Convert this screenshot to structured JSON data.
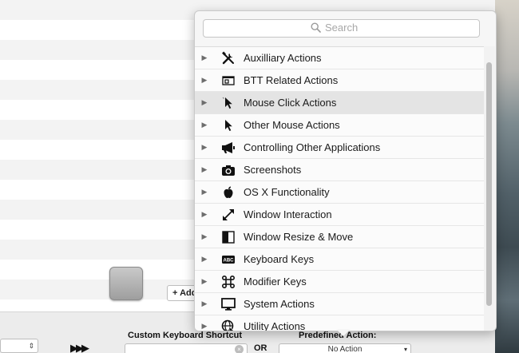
{
  "background": {
    "add_button": "+ Add",
    "shortcut_label": "Custom Keyboard Shortcut",
    "or_label": "OR",
    "predefined_label": "Predefined Action:",
    "predefined_value": "No Action"
  },
  "popover": {
    "search_placeholder": "Search",
    "items": [
      {
        "label": "Auxilliary Actions",
        "icon": "tools-icon"
      },
      {
        "label": "BTT Related Actions",
        "icon": "btt-window-icon"
      },
      {
        "label": "Mouse Click Actions",
        "icon": "cursor-click-icon",
        "highlighted": true
      },
      {
        "label": "Other Mouse Actions",
        "icon": "cursor-icon"
      },
      {
        "label": "Controlling Other Applications",
        "icon": "megaphone-icon"
      },
      {
        "label": "Screenshots",
        "icon": "camera-icon"
      },
      {
        "label": "OS X Functionality",
        "icon": "apple-icon"
      },
      {
        "label": "Window Interaction",
        "icon": "resize-arrows-icon"
      },
      {
        "label": "Window Resize & Move",
        "icon": "half-window-icon"
      },
      {
        "label": "Keyboard Keys",
        "icon": "abc-keyboard-icon"
      },
      {
        "label": "Modifier Keys",
        "icon": "command-key-icon"
      },
      {
        "label": "System Actions",
        "icon": "monitor-icon"
      },
      {
        "label": "Utility Actions",
        "icon": "globe-cursor-icon"
      }
    ]
  }
}
